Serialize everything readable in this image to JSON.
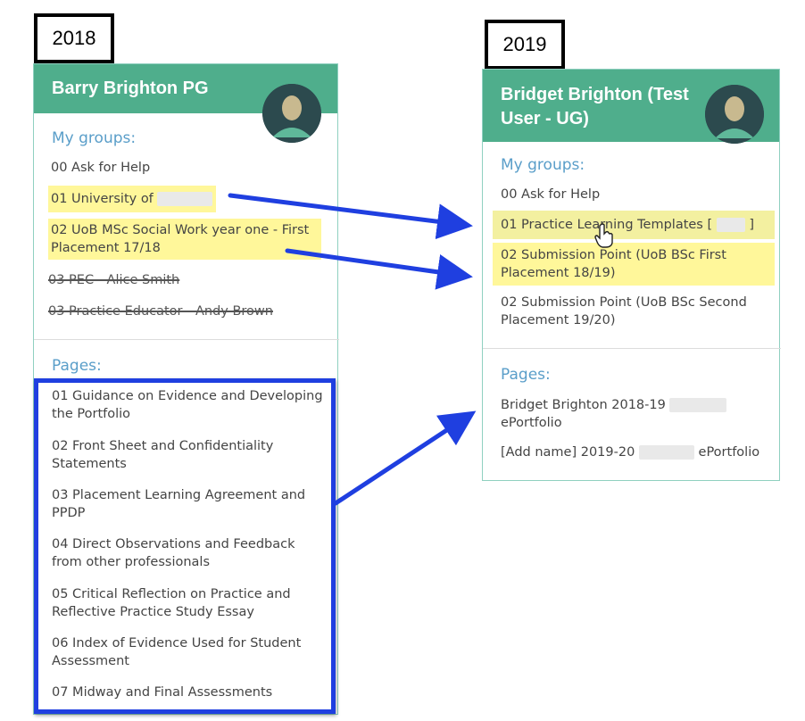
{
  "left": {
    "year": "2018",
    "user_name": "Barry Brighton PG",
    "groups_title": "My groups:",
    "groups": [
      {
        "label": "00 Ask for Help",
        "highlight": false,
        "strike": false
      },
      {
        "label": "01 University of",
        "highlight": true,
        "strike": false
      },
      {
        "label": "02 UoB MSc Social Work year one - First",
        "label2": "Placement 17/18",
        "highlight": true,
        "strike": false
      },
      {
        "label": "03 PEC - Alice Smith",
        "highlight": false,
        "strike": true
      },
      {
        "label": "03 Practice Educator - Andy Brown",
        "highlight": false,
        "strike": true
      }
    ],
    "pages_title": "Pages:",
    "pages": [
      {
        "line1": "01 Guidance on Evidence and Developing",
        "line2": "the Portfolio"
      },
      {
        "line1": "02 Front Sheet and Confidentiality",
        "line2": "Statements"
      },
      {
        "line1": "03 Placement Learning Agreement and",
        "line2": "PPDP"
      },
      {
        "line1": "04 Direct Observations and Feedback",
        "line2": "from other professionals"
      },
      {
        "line1": "05 Critical Reflection on Practice and",
        "line2": "Reflective Practice Study Essay"
      },
      {
        "line1": "06 Index of Evidence Used for Student",
        "line2": "Assessment"
      },
      {
        "line1": "07 Midway and Final Assessments",
        "line2": ""
      }
    ]
  },
  "right": {
    "year": "2019",
    "user_name_line1": "Bridget Brighton (Test",
    "user_name_line2": "User - UG)",
    "groups_title": "My groups:",
    "groups": [
      {
        "label": "00 Ask for Help",
        "highlight": false
      },
      {
        "label": "01 Practice Learning Templates [",
        "label_end": "]",
        "highlight": true
      },
      {
        "label": "02 Submission Point (UoB BSc First",
        "label2": "Placement 18/19)",
        "highlight": true
      },
      {
        "label": "02 Submission Point (UoB BSc Second",
        "label2": "Placement 19/20)",
        "highlight": false
      }
    ],
    "pages_title": "Pages:",
    "pages": [
      {
        "line1": "Bridget Brighton 2018-19",
        "line2": "ePortfolio"
      },
      {
        "line1": "[Add name] 2019-20",
        "line1_end": "ePortfolio"
      }
    ]
  },
  "colors": {
    "header_green": "#4fae8c",
    "highlight_yellow": "#fff79a",
    "arrow_blue": "#1f3fe0",
    "section_blue": "#5a9ec9"
  },
  "icons": [
    "avatar-icon",
    "hand-cursor-icon",
    "arrow-icon"
  ]
}
